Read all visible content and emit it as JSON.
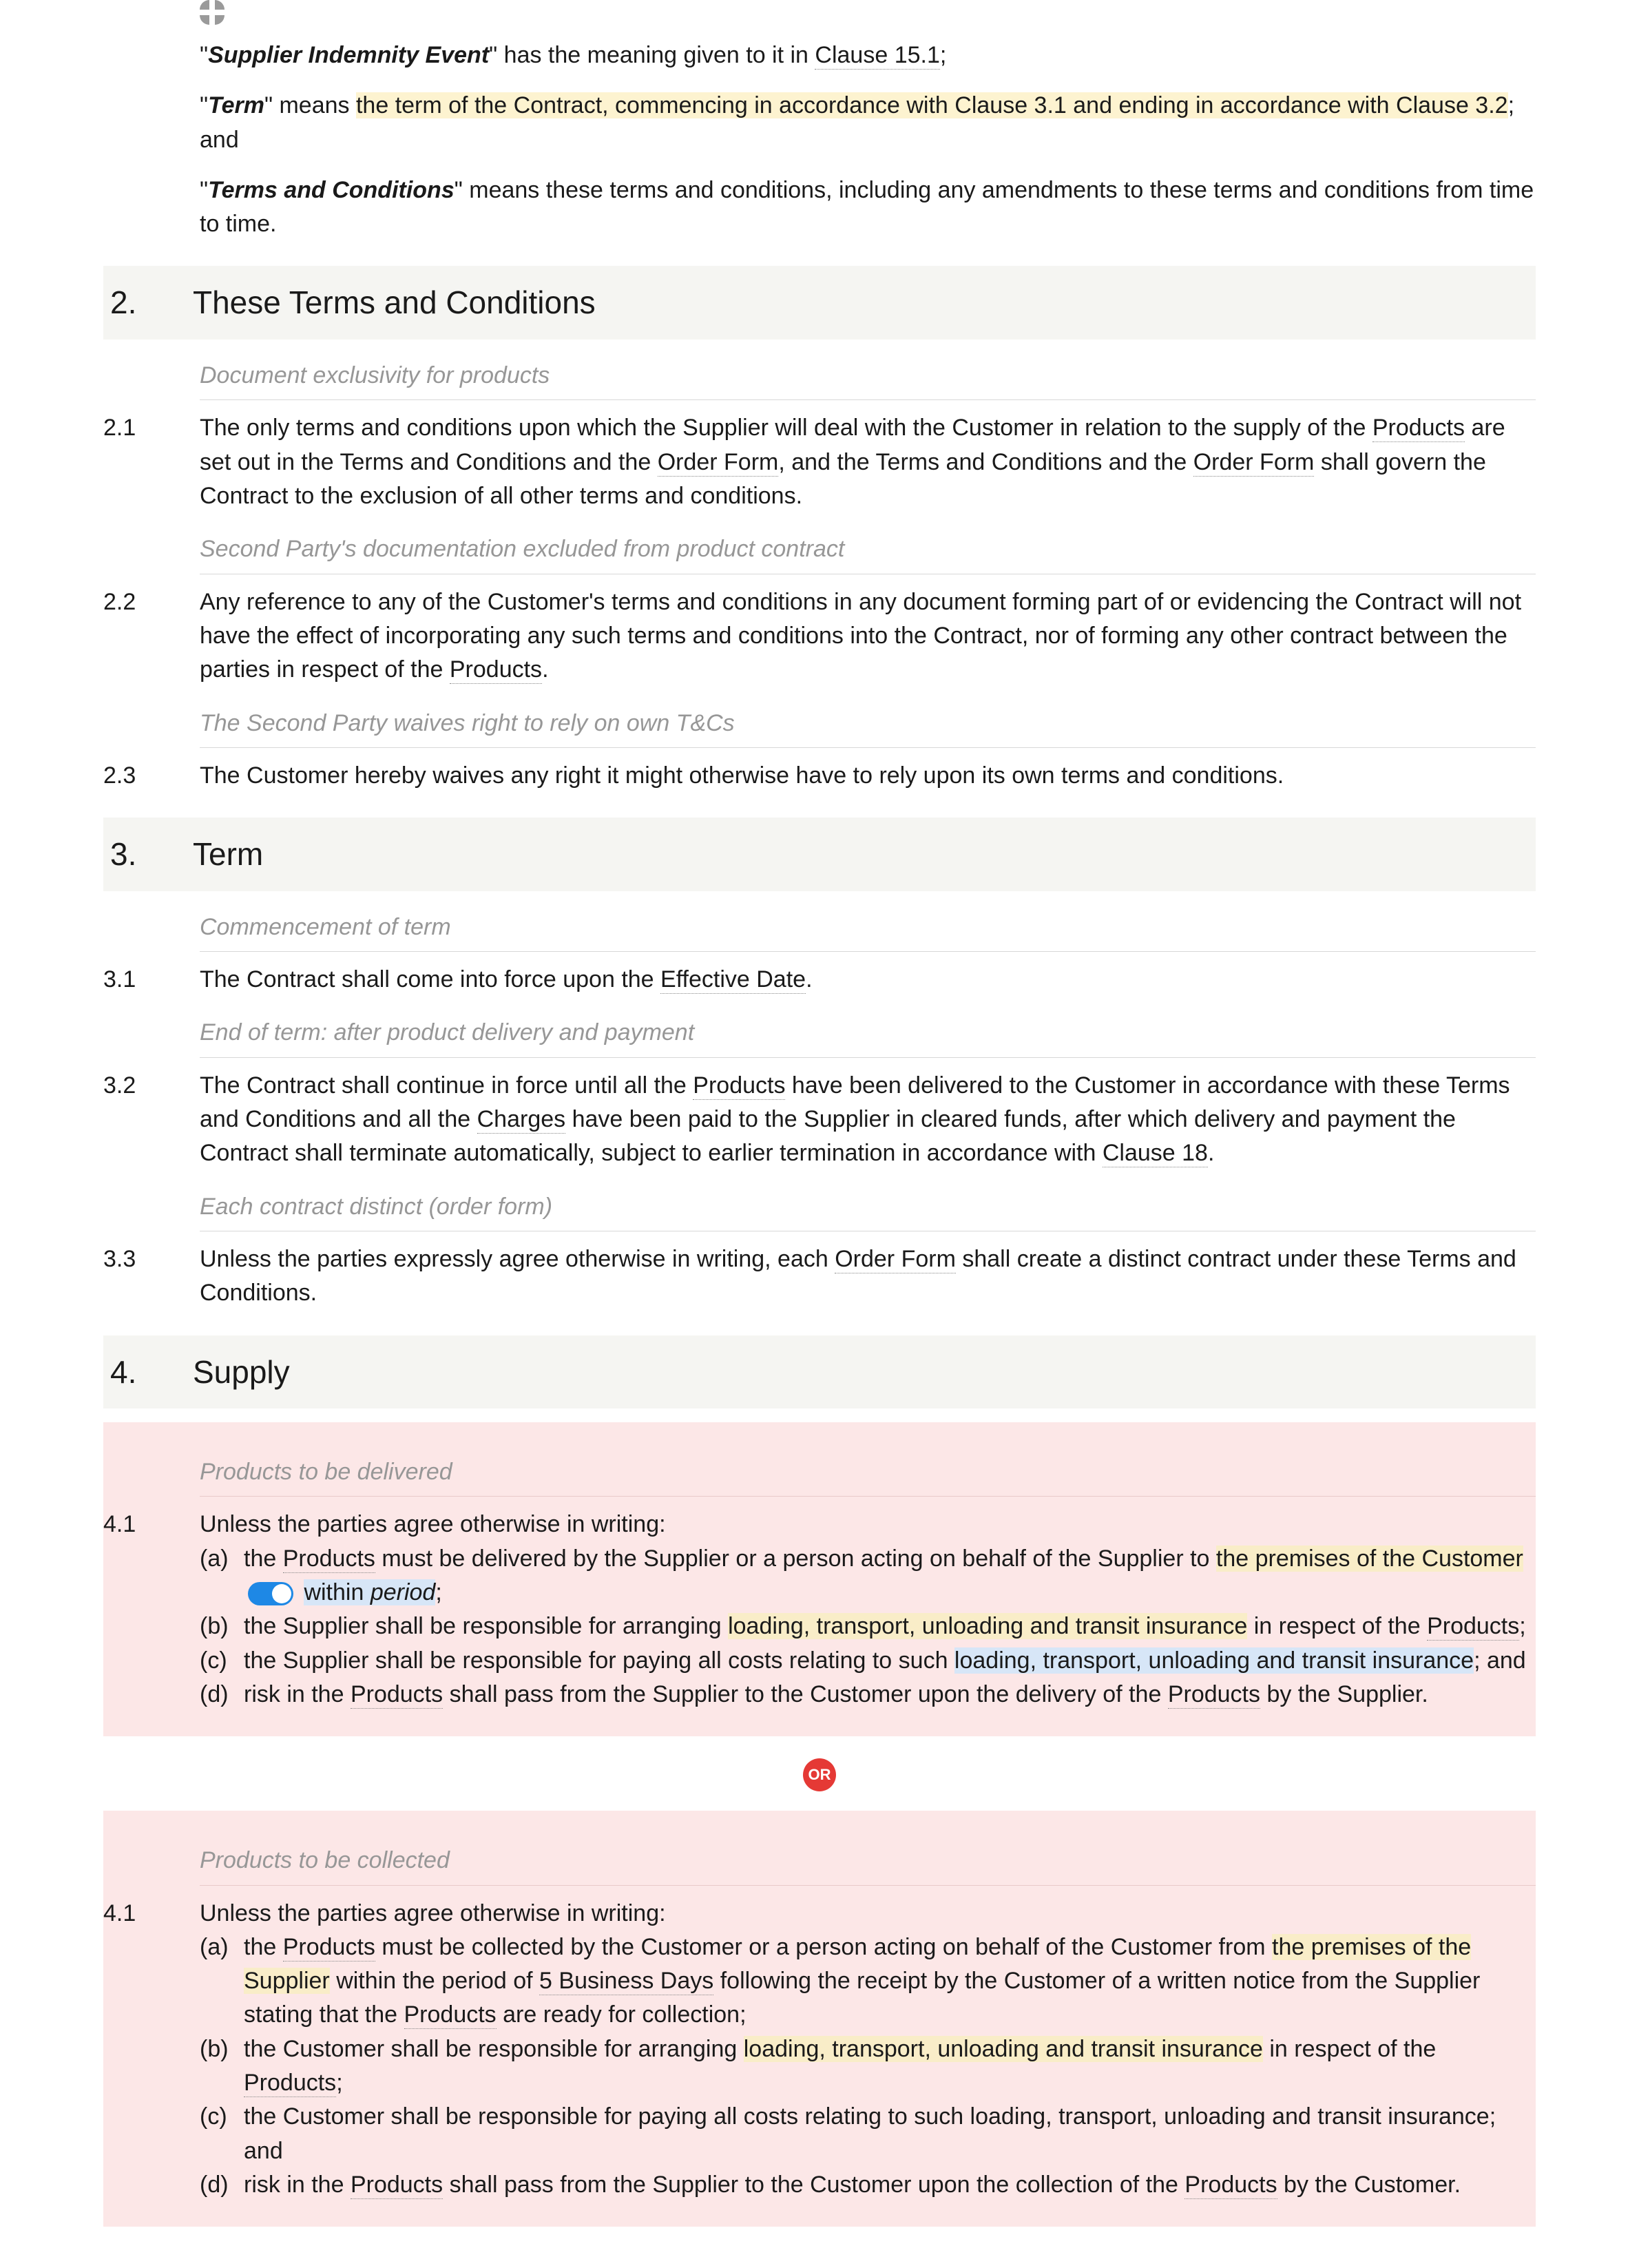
{
  "def1": {
    "term": "Supplier Indemnity Event",
    "body": "\" has the meaning given to it in ",
    "clauseRef": "Clause 15.1",
    "after": ";"
  },
  "def2": {
    "term": "Term",
    "body": "\" means ",
    "hl": "the term of the Contract, commencing in accordance with Clause 3.1 and ending in accordance with Clause 3.2",
    "after": "; and"
  },
  "def3": {
    "term": "Terms and Conditions",
    "body": "\" means these terms and conditions, including any amendments to these terms and conditions from time to time."
  },
  "s2": {
    "num": "2.",
    "title": "These Terms and Conditions"
  },
  "s2_1_sub": "Document exclusivity for products",
  "s2_1": {
    "num": "2.1",
    "p1": "The only terms and conditions upon which the Supplier will deal with the Customer in relation to the supply of the ",
    "products": "Products",
    "p2": " are set out in the Terms and Conditions and the ",
    "orderForm1": "Order Form",
    "p3": ", and the Terms and Conditions and the ",
    "orderForm2": "Order Form",
    "p4": " shall govern the Contract to the exclusion of all other terms and conditions."
  },
  "s2_2_sub": "Second Party's documentation excluded from product contract",
  "s2_2": {
    "num": "2.2",
    "p1": "Any reference to any of the Customer's terms and conditions in any document forming part of or evidencing the Contract will not have the effect of incorporating any such terms and conditions into the Contract, nor of forming any other contract between the parties in respect of the ",
    "products": "Products",
    "p2": "."
  },
  "s2_3_sub": "The Second Party waives right to rely on own T&Cs",
  "s2_3": {
    "num": "2.3",
    "body": "The Customer hereby waives any right it might otherwise have to rely upon its own terms and conditions."
  },
  "s3": {
    "num": "3.",
    "title": "Term"
  },
  "s3_1_sub": "Commencement of term",
  "s3_1": {
    "num": "3.1",
    "p1": "The Contract shall come into force upon the ",
    "eff": "Effective Date",
    "p2": "."
  },
  "s3_2_sub": "End of term: after product delivery and payment",
  "s3_2": {
    "num": "3.2",
    "p1": "The Contract shall continue in force until all the ",
    "products": "Products",
    "p2": " have been delivered to the Customer in accordance with these Terms and Conditions and all the ",
    "charges": "Charges",
    "p3": " have been paid to the Supplier in cleared funds, after which delivery and payment the Contract shall terminate automatically, subject to earlier termination in accordance with ",
    "clause18": "Clause 18",
    "p4": "."
  },
  "s3_3_sub": "Each contract distinct (order form)",
  "s3_3": {
    "num": "3.3",
    "p1": "Unless the parties expressly agree otherwise in writing, each ",
    "orderForm": "Order Form",
    "p2": " shall create a distinct contract under these Terms and Conditions."
  },
  "s4": {
    "num": "4.",
    "title": "Supply"
  },
  "s4_1a_sub": "Products to be delivered",
  "s4_1a": {
    "num": "4.1",
    "intro": "Unless the parties agree otherwise in writing:",
    "a": {
      "l": "(a)",
      "t1": "the ",
      "products": "Products",
      "t2": " must be delivered by the Supplier or a person acting on behalf of the Supplier to ",
      "premises": "the premises of the Customer",
      "within": " within ",
      "period": "period",
      "semicolon": ";"
    },
    "b": {
      "l": "(b)",
      "t1": "the Supplier shall be responsible for arranging ",
      "hl": "loading, transport, unloading and transit insurance",
      "t2": " in respect of the ",
      "products": "Products",
      "t3": ";"
    },
    "c": {
      "l": "(c)",
      "t1": "the Supplier shall be responsible for paying all costs relating to such ",
      "hl": "loading, transport, unloading and transit insurance",
      "t2": "; and"
    },
    "d": {
      "l": "(d)",
      "t1": "risk in the ",
      "products1": "Products",
      "t2": " shall pass from the Supplier to the Customer upon the delivery of the ",
      "products2": "Products",
      "t3": " by the Supplier."
    }
  },
  "orLabel": "OR",
  "s4_1b_sub": "Products to be collected",
  "s4_1b": {
    "num": "4.1",
    "intro": "Unless the parties agree otherwise in writing:",
    "a": {
      "l": "(a)",
      "t1": "the ",
      "products1": "Products",
      "t2": " must be collected by the Customer or a person acting on behalf of the Customer from ",
      "premises": "the premises of the Supplier",
      "t3": " within the period of ",
      "days": "5 Business Days",
      "t4": " following the receipt by the Customer of a written notice from the Supplier stating that the ",
      "products2": "Products",
      "t5": " are ready for collection;"
    },
    "b": {
      "l": "(b)",
      "t1": "the Customer shall be responsible for arranging ",
      "hl": "loading, transport, unloading and transit insurance",
      "t2": " in respect of the ",
      "products": "Products",
      "t3": ";"
    },
    "c": {
      "l": "(c)",
      "t": "the Customer shall be responsible for paying all costs relating to such loading, transport, unloading and transit insurance; and"
    },
    "d": {
      "l": "(d)",
      "t1": "risk in the ",
      "products1": "Products",
      "t2": " shall pass from the Supplier to the Customer upon the collection of the ",
      "products2": "Products",
      "t3": " by the Customer."
    }
  }
}
